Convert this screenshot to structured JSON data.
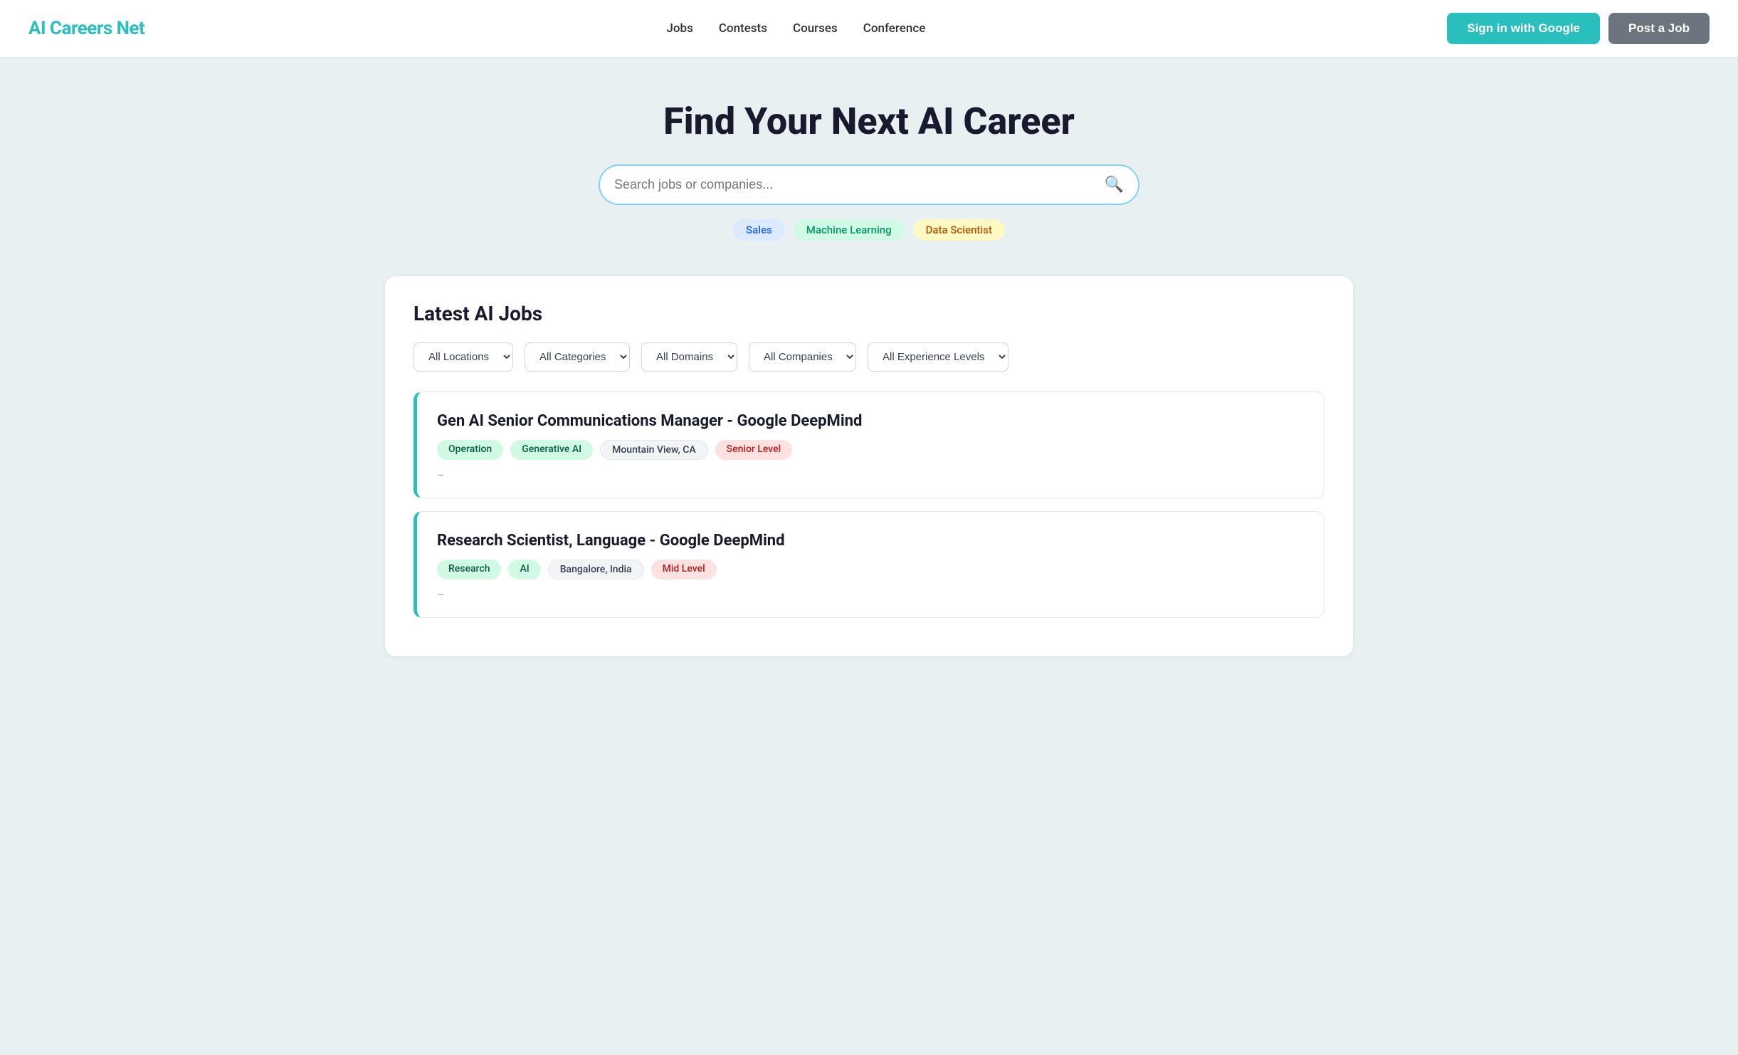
{
  "header": {
    "logo": "AI Careers Net",
    "nav": {
      "items": [
        {
          "label": "Jobs",
          "href": "#"
        },
        {
          "label": "Contests",
          "href": "#"
        },
        {
          "label": "Courses",
          "href": "#"
        },
        {
          "label": "Conference",
          "href": "#"
        }
      ]
    },
    "signin_label": "Sign in with Google",
    "post_job_label": "Post a Job"
  },
  "hero": {
    "title": "Find Your Next AI Career",
    "search_placeholder": "Search jobs or companies...",
    "tags": [
      {
        "label": "Sales",
        "style": "blue"
      },
      {
        "label": "Machine Learning",
        "style": "green"
      },
      {
        "label": "Data Scientist",
        "style": "yellow"
      }
    ]
  },
  "jobs": {
    "section_title": "Latest AI Jobs",
    "filters": {
      "locations_label": "All Locations",
      "categories_label": "All Categories",
      "domains_label": "All Domains",
      "companies_label": "All Companies",
      "experience_label": "All Experience Levels"
    },
    "items": [
      {
        "title": "Gen AI Senior Communications Manager - Google DeepMind",
        "tags": [
          {
            "label": "Operation",
            "style": "operation"
          },
          {
            "label": "Generative AI",
            "style": "generative"
          },
          {
            "label": "Mountain View, CA",
            "style": "location"
          },
          {
            "label": "Senior Level",
            "style": "senior"
          }
        ],
        "dash": "–"
      },
      {
        "title": "Research Scientist, Language - Google DeepMind",
        "tags": [
          {
            "label": "Research",
            "style": "research"
          },
          {
            "label": "AI",
            "style": "ai"
          },
          {
            "label": "Bangalore, India",
            "style": "location"
          },
          {
            "label": "Mid Level",
            "style": "mid"
          }
        ],
        "dash": "–"
      }
    ]
  }
}
